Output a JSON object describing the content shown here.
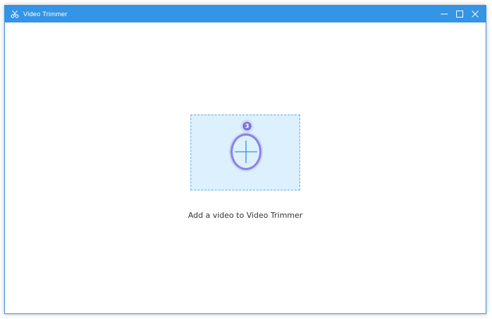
{
  "window": {
    "title": "Video Trimmer",
    "icons": {
      "app": "scissors-icon",
      "minimize": "minimize-icon",
      "maximize": "maximize-icon",
      "close": "close-icon"
    }
  },
  "main": {
    "drop_zone": {
      "icon": "plus-icon",
      "badge": "3"
    },
    "hint": "Add a video to Video Trimmer"
  },
  "colors": {
    "titlebar": "#3494e6",
    "drop_zone_bg": "#dcf0fd",
    "drop_zone_border": "#5fb0e6",
    "accent_purple": "#8a85e0"
  }
}
